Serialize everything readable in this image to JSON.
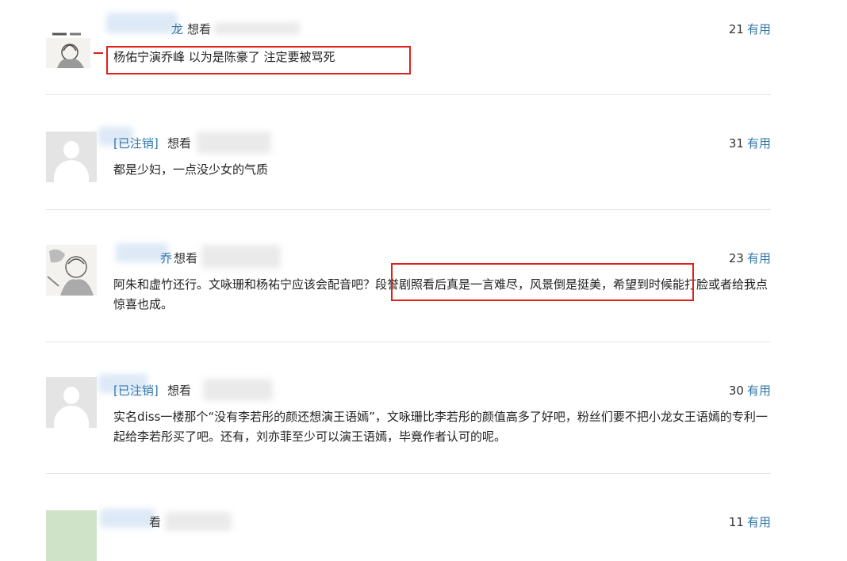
{
  "comments": [
    {
      "user": "龙",
      "status": "想看",
      "text": "杨佑宁演乔峰 以为是陈豪了 注定要被骂死",
      "votes": "21",
      "useful": "有用"
    },
    {
      "user": "[已注销]",
      "status": "想看",
      "text": "都是少妇，一点没少女的气质",
      "votes": "31",
      "useful": "有用"
    },
    {
      "user": "乔",
      "status": "想看",
      "text": "阿朱和虚竹还行。文咏珊和杨祐宁应该会配音吧？段誉剧照看后真是一言难尽，风景倒是挺美，希望到时候能打脸或者给我点惊喜也成。",
      "votes": "23",
      "useful": "有用"
    },
    {
      "user": "[已注销]",
      "status": "想看",
      "text": "实名diss一楼那个“没有李若彤的颜还想演王语嫣”，文咏珊比李若彤的颜值高多了好吧，粉丝们要不把小龙女王语嫣的专利一起给李若彤买了吧。还有，刘亦菲至少可以演王语嫣，毕竟作者认可的呢。",
      "votes": "30",
      "useful": "有用"
    },
    {
      "user": "",
      "status": "看",
      "text": "",
      "votes": "11",
      "useful": "有用"
    }
  ]
}
